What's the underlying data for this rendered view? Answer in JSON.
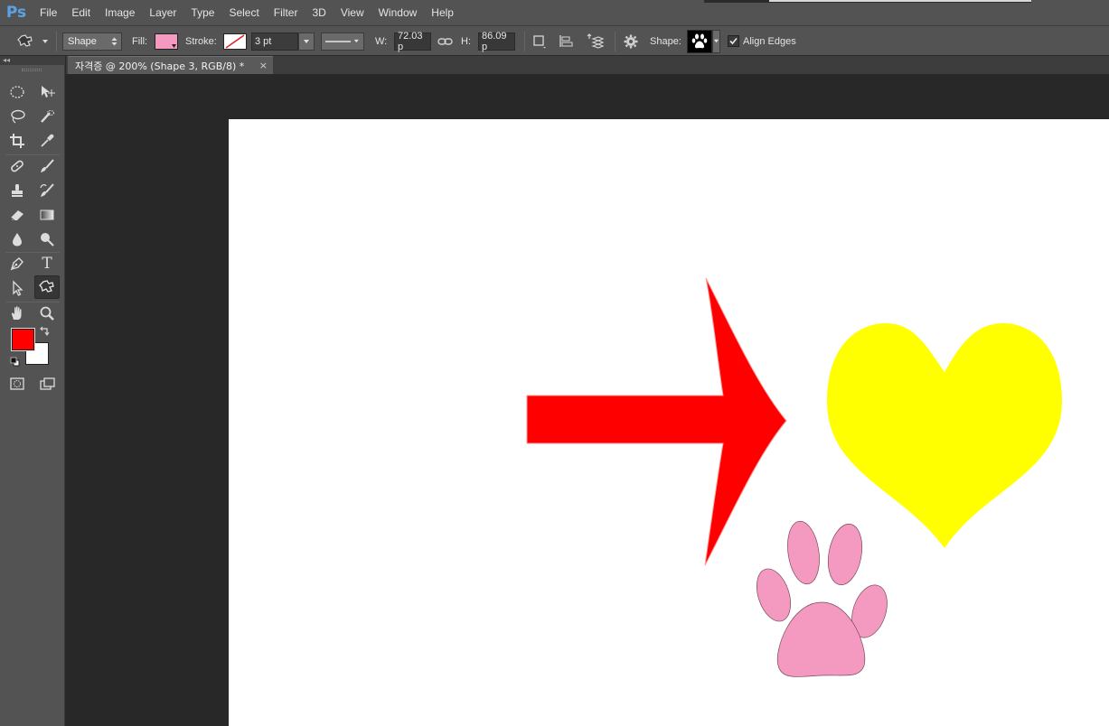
{
  "app": {
    "logo": "Ps"
  },
  "menu": [
    "File",
    "Edit",
    "Image",
    "Layer",
    "Type",
    "Select",
    "Filter",
    "3D",
    "View",
    "Window",
    "Help"
  ],
  "options": {
    "tool_icon": "custom-shape-tool-icon",
    "mode": "Shape",
    "fill_label": "Fill:",
    "fill_color": "#f49ac1",
    "stroke_label": "Stroke:",
    "stroke_width": "3 pt",
    "width_label": "W:",
    "width_value": "72.03 p",
    "height_label": "H:",
    "height_value": "86.09 p",
    "shape_label": "Shape:",
    "align_edges_label": "Align Edges",
    "align_edges_checked": true
  },
  "document": {
    "tab_title": "자격증 @ 200% (Shape 3, RGB/8) *",
    "close": "×"
  },
  "tools": {
    "foreground_color": "#ff0000",
    "background_color": "#ffffff",
    "type_tool_glyph": "T"
  },
  "canvas": {
    "arrow_color": "#ff0000",
    "heart_color": "#ffff00",
    "paw_color": "#f49ac1"
  }
}
